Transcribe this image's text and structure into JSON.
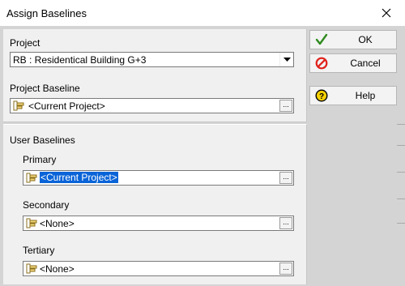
{
  "window": {
    "title": "Assign Baselines"
  },
  "project": {
    "label": "Project",
    "selected": "RB : Residentical Building G+3"
  },
  "project_baseline": {
    "label": "Project Baseline",
    "value": "<Current Project>"
  },
  "user_baselines": {
    "label": "User Baselines",
    "primary": {
      "label": "Primary",
      "value": "<Current Project>"
    },
    "secondary": {
      "label": "Secondary",
      "value": "<None>"
    },
    "tertiary": {
      "label": "Tertiary",
      "value": "<None>"
    }
  },
  "buttons": {
    "ok": "OK",
    "cancel": "Cancel",
    "help": "Help"
  },
  "browse_label": "...",
  "colors": {
    "selection": "#0a64d8",
    "ok_check": "#2e8b1f",
    "cancel_red": "#e0221c",
    "help_yellow": "#f5d000"
  }
}
